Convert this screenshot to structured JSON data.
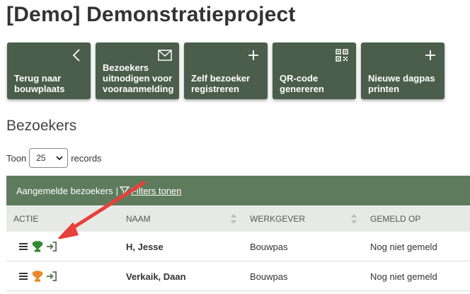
{
  "page": {
    "title": "[Demo] Demonstratieproject"
  },
  "tiles": [
    {
      "label": "Terug naar\nbouwplaats",
      "icon": "chevron-left-icon"
    },
    {
      "label": "Bezoekers\nuitnodigen voor\nvooraanmelding",
      "icon": "envelope-icon"
    },
    {
      "label": "Zelf bezoeker\nregistreren",
      "icon": "plus-icon"
    },
    {
      "label": "QR-code\ngenereren",
      "icon": "qr-code-icon"
    },
    {
      "label": "Nieuwe dagpas\nprinten",
      "icon": "plus-icon"
    }
  ],
  "section": {
    "title": "Bezoekers"
  },
  "length_control": {
    "before": "Toon",
    "value": "25",
    "after": "records"
  },
  "panel": {
    "title": "Aangemelde bezoekers",
    "separator": "|",
    "filter_label": "Filters tonen"
  },
  "table": {
    "columns": [
      "ACTIE",
      "NAAM",
      "WERKGEVER",
      "GEMELD OP"
    ],
    "rows": [
      {
        "name": "H, Jesse",
        "employer": "Bouwpas",
        "reported": "Nog niet gemeld",
        "trophy_color": "#2e8b2e"
      },
      {
        "name": "Verkaik, Daan",
        "employer": "Bouwpas",
        "reported": "Nog niet gemeld",
        "trophy_color": "#e8882a"
      }
    ]
  },
  "colors": {
    "tile_bg": "#4a5e4b",
    "panel_header": "#5e7c5d",
    "arrow": "#e8403a",
    "login_icon": "#5e7c5d"
  }
}
